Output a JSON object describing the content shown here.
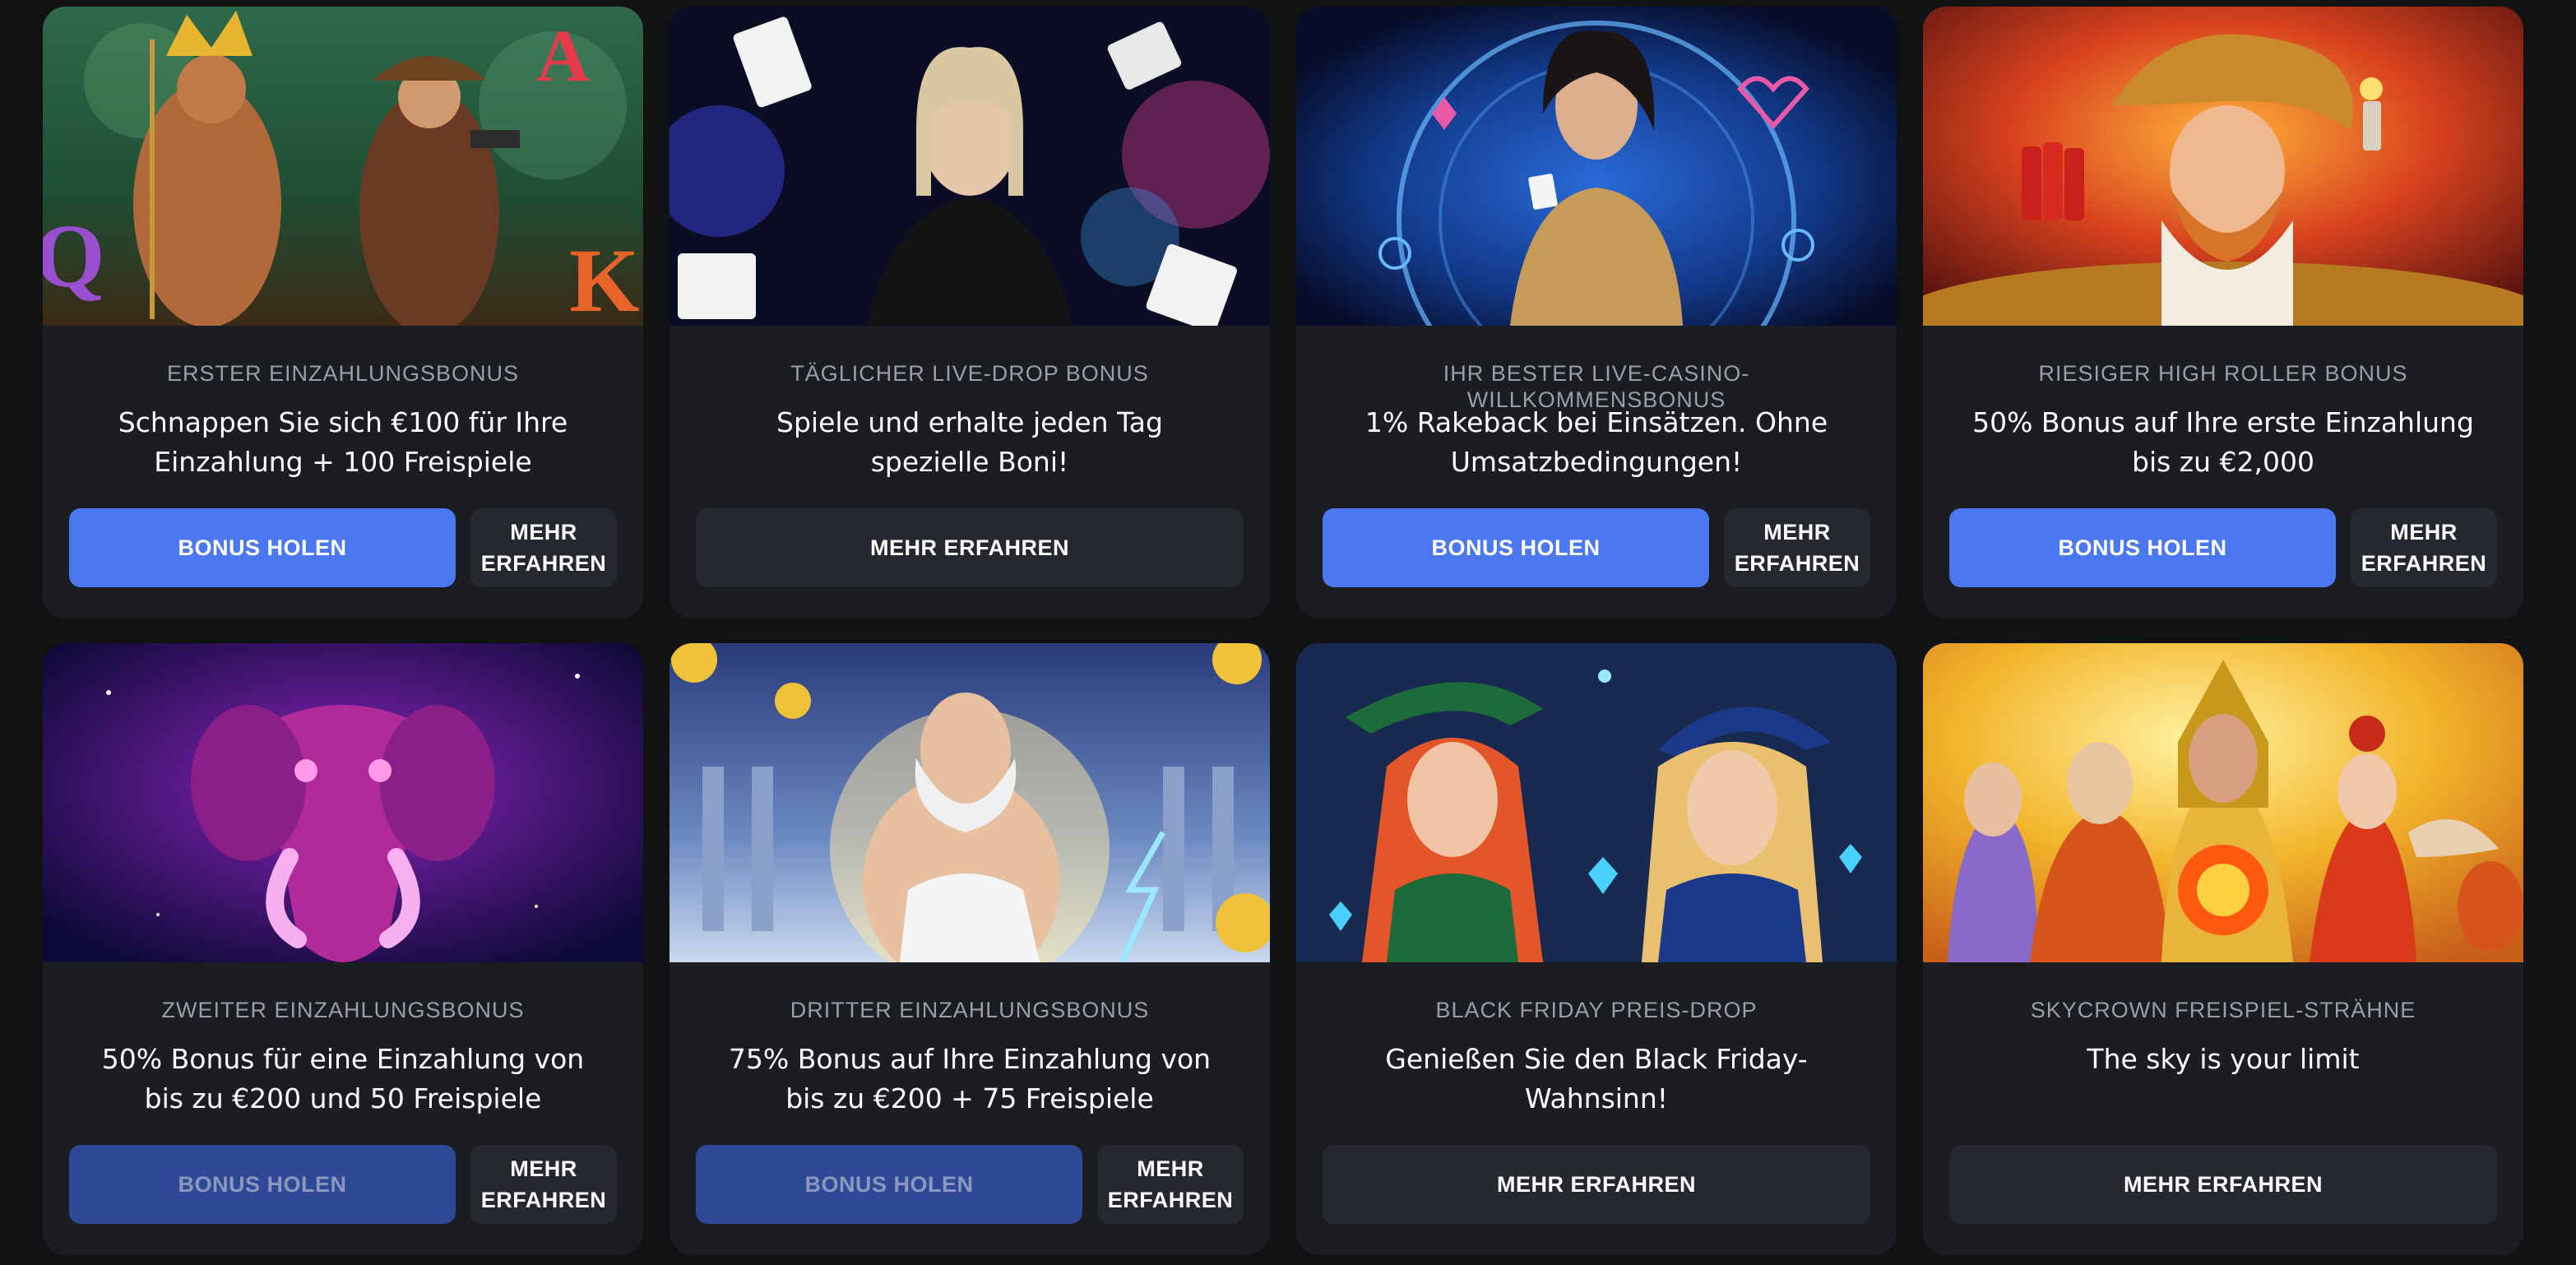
{
  "colors": {
    "page_bg": "#111214",
    "card_bg": "#1b1d22",
    "primary_button": "#4b78f0",
    "primary_button_disabled": "#2f4996",
    "secondary_button": "#26282f",
    "category_text": "#9a9ea8"
  },
  "cards": [
    {
      "art_icon": "jungle-adventure-slot-art",
      "category": "ERSTER EINZAHLUNGSBONUS",
      "title": "Schnappen Sie sich €100 für Ihre Einzahlung + 100 Freispiele",
      "primary_label": "BONUS HOLEN",
      "secondary_label": "MEHR ERFAHREN",
      "primary_disabled": false
    },
    {
      "art_icon": "live-dealer-cards-art",
      "category": "TÄGLICHER LIVE-DROP BONUS",
      "title": "Spiele und erhalte jeden Tag spezielle Boni!",
      "wide_label": "MEHR ERFAHREN"
    },
    {
      "art_icon": "live-casino-hostess-art",
      "category": "IHR BESTER LIVE-CASINO-WILLKOMMENSBONUS",
      "title": "1% Rakeback bei Einsätzen. Ohne Umsatzbedingungen!",
      "primary_label": "BONUS HOLEN",
      "secondary_label": "MEHR ERFAHREN",
      "primary_disabled": false
    },
    {
      "art_icon": "gold-miner-dynamite-art",
      "category": "RIESIGER HIGH ROLLER BONUS",
      "title": "50% Bonus auf Ihre erste Einzahlung bis zu €2,000",
      "primary_label": "BONUS HOLEN",
      "secondary_label": "MEHR ERFAHREN",
      "primary_disabled": false
    },
    {
      "art_icon": "pink-elephant-art",
      "category": "ZWEITER EINZAHLUNGSBONUS",
      "title": "50% Bonus für eine Einzahlung von bis zu €200 und 50 Freispiele",
      "primary_label": "BONUS HOLEN",
      "secondary_label": "MEHR ERFAHREN",
      "primary_disabled": true
    },
    {
      "art_icon": "zeus-olympus-art",
      "category": "DRITTER EINZAHLUNGSBONUS",
      "title": "75% Bonus auf Ihre Einzahlung von bis zu €200 + 75 Freispiele",
      "primary_label": "BONUS HOLEN",
      "secondary_label": "MEHR ERFAHREN",
      "primary_disabled": true
    },
    {
      "art_icon": "witches-crystals-art",
      "category": "BLACK FRIDAY PREIS-DROP",
      "title": "Genießen Sie den Black Friday-Wahnsinn!",
      "wide_label": "MEHR ERFAHREN"
    },
    {
      "art_icon": "asian-heroes-fireball-art",
      "category": "SKYCROWN FREISPIEL-STRÄHNE",
      "title": "The sky is your limit",
      "wide_label": "MEHR ERFAHREN"
    }
  ]
}
